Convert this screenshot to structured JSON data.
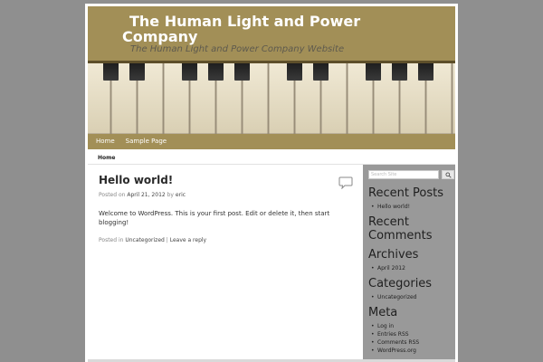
{
  "site": {
    "title": "The Human Light and Power Company",
    "description": "The Human Light and Power Company Website"
  },
  "nav": {
    "items": [
      "Home",
      "Sample Page"
    ]
  },
  "breadcrumb": "Home",
  "post": {
    "title": "Hello world!",
    "meta_prefix": "Posted on",
    "date": "April 21, 2012",
    "by": "by",
    "author": "eric",
    "body": "Welcome to WordPress. This is your first post. Edit or delete it, then start blogging!",
    "posted_in": "Posted in",
    "category": "Uncategorized",
    "separator": "|",
    "reply": "Leave a reply"
  },
  "sidebar": {
    "search_placeholder": "Search Site",
    "recent_posts_title": "Recent Posts",
    "recent_posts": [
      "Hello world!"
    ],
    "recent_comments_title": "Recent Comments",
    "archives_title": "Archives",
    "archives": [
      "April 2012"
    ],
    "categories_title": "Categories",
    "categories": [
      "Uncategorized"
    ],
    "meta_title": "Meta",
    "meta": [
      "Log in",
      "Entries RSS",
      "Comments RSS",
      "WordPress.org"
    ]
  },
  "colors": {
    "header": "#a28f57",
    "page_bg": "#8f8f8f",
    "sidebar": "#999999"
  }
}
